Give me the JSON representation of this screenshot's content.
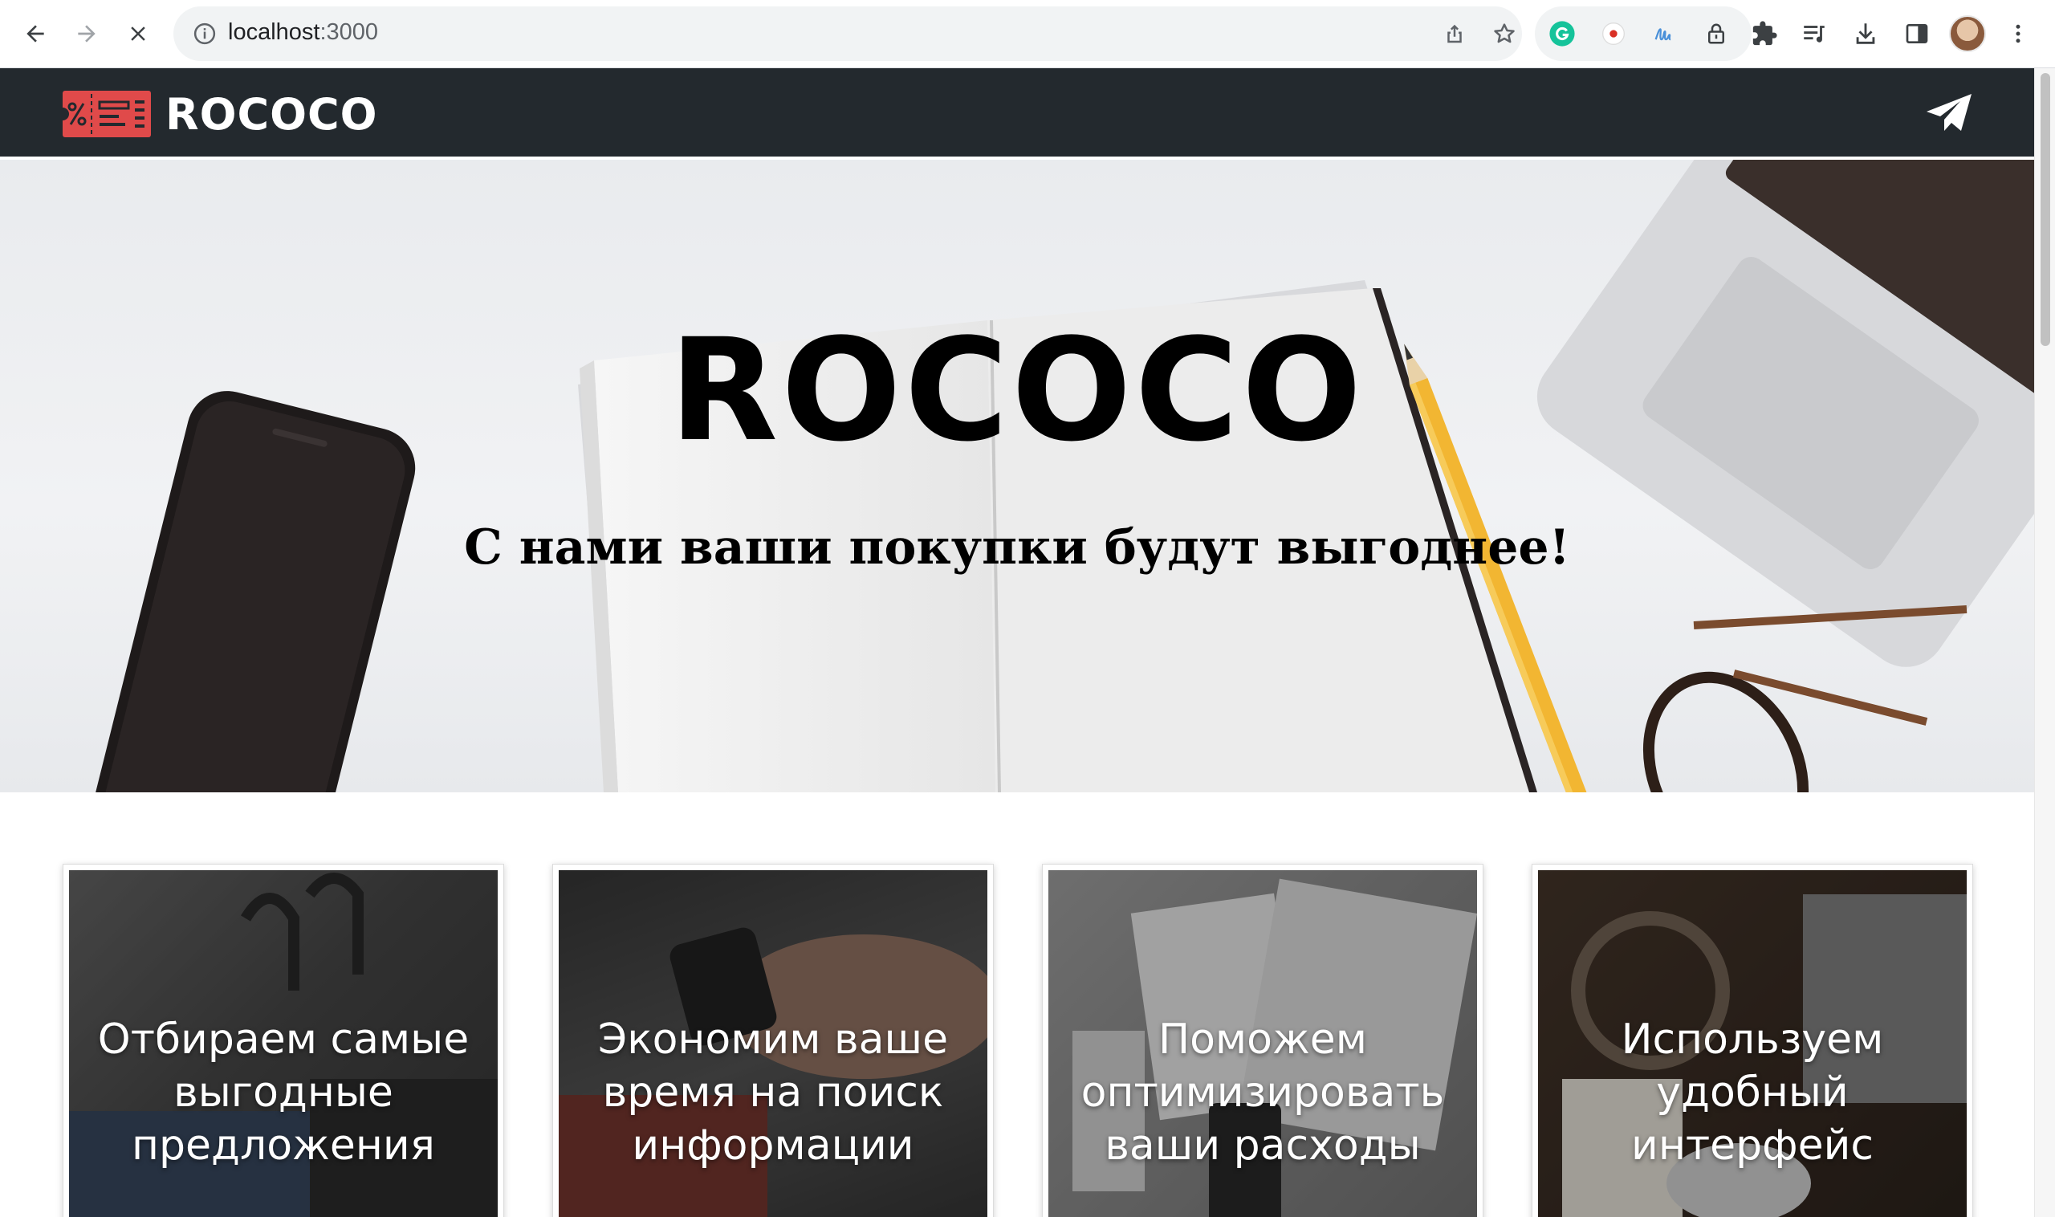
{
  "browser": {
    "url_host": "localhost",
    "url_port": ":3000",
    "loading": true,
    "icons": {
      "back": "arrow-left-icon",
      "forward": "arrow-right-icon",
      "stop": "close-icon",
      "info": "info-icon",
      "share": "share-icon",
      "bookmark": "star-icon",
      "extensions": [
        "grammarly-icon",
        "record-icon",
        "handwriting-icon",
        "lock-extension-icon",
        "puzzle-icon"
      ],
      "reading_list": "reading-list-icon",
      "download": "download-icon",
      "side_panel": "side-panel-icon",
      "menu": "kebab-menu-icon"
    }
  },
  "site": {
    "brand": "ROCOCO",
    "colors": {
      "header_bg": "#23292e",
      "logo_red": "#e04a4a"
    },
    "hero": {
      "title": "ROCOCO",
      "subtitle": "С нами ваши покупки будут выгоднее!"
    },
    "cards": [
      {
        "line1": "Отбираем самые",
        "line2": "выгодные",
        "line3": "предложения"
      },
      {
        "line1": "Экономим ваше",
        "line2": "время на поиск",
        "line3": "информации"
      },
      {
        "line1": "Поможем",
        "line2": "оптимизировать",
        "line3": "ваши расходы"
      },
      {
        "line1": "Используем",
        "line2": "удобный",
        "line3": "интерфейс"
      }
    ]
  }
}
